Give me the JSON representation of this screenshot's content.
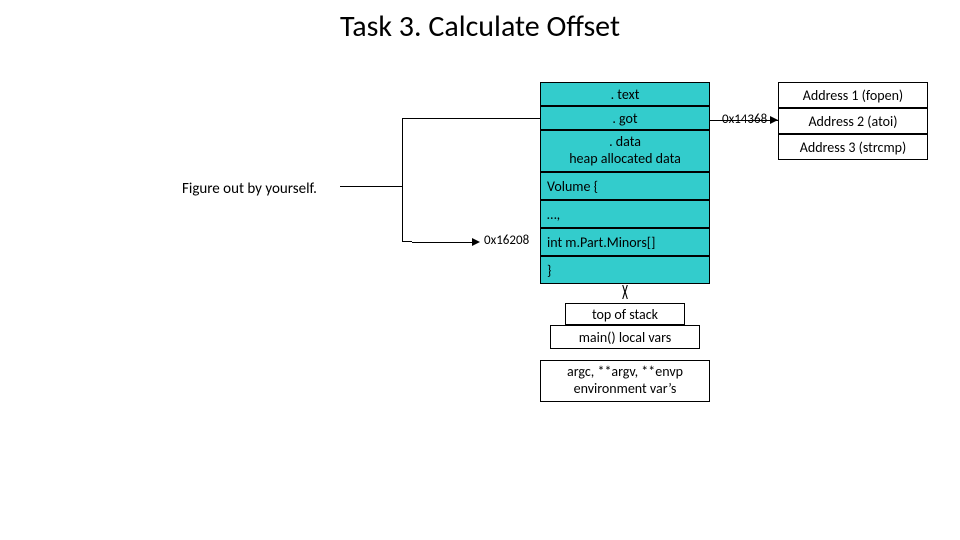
{
  "title": "Task 3. Calculate Offset",
  "figure_label": "Figure out by yourself.",
  "addr_left": "0x16208",
  "addr_right": "0x14368",
  "left_stack": {
    "text": ". text",
    "got": ". got",
    "data": ". data\nheap allocated data",
    "volume_open": "Volume {",
    "dots": "…,",
    "minors": "int m.Part.Minors[]",
    "close": "}",
    "top_of_stack": "top of stack",
    "main_locals": "main() local vars",
    "arg_env": "argc, **argv, **envp\nenvironment var’s"
  },
  "right_stack": {
    "a1": "Address 1 (fopen)",
    "a2": "Address 2 (atoi)",
    "a3": "Address 3 (strcmp)"
  },
  "chart_data": {
    "type": "table",
    "title": "Task 3. Calculate Offset",
    "memory_layout": [
      ". text",
      ". got",
      ". data / heap allocated data",
      "Volume {",
      "…,",
      "int m.Part.Minors[]",
      "}",
      "top of stack",
      "main() local vars",
      "argc, **argv, **envp / environment var’s"
    ],
    "got_entries": [
      "Address 1 (fopen)",
      "Address 2 (atoi)",
      "Address 3 (strcmp)"
    ],
    "annotations": {
      "got_address": "0x14368",
      "minors_address": "0x16208",
      "note": "Figure out by yourself."
    },
    "relations": [
      {
        "from": ". got",
        "to": "Address 2 (atoi)",
        "label": "0x14368"
      },
      {
        "from": "int m.Part.Minors[]",
        "label": "0x16208"
      }
    ]
  }
}
